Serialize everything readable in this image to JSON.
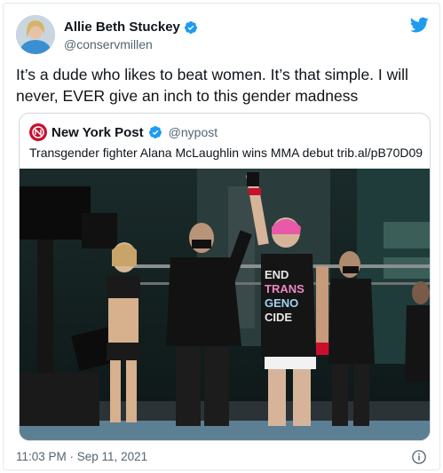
{
  "tweet": {
    "display_name": "Allie Beth Stuckey",
    "handle": "@conservmillen",
    "text": "It’s a dude who likes to beat women. It’s that simple. I will never, EVER give an inch to this gender madness",
    "timestamp": "11:03 PM · Sep 11, 2021"
  },
  "quote": {
    "display_name": "New York Post",
    "handle": "@nypost",
    "text": "Transgender fighter Alana McLaughlin wins MMA debut trib.al/pB70D09",
    "image_shirt_text": "END TRANS GENO CIDE"
  },
  "icons": {
    "verified": "verified-badge-icon",
    "brand": "twitter-bird-icon",
    "info": "info-icon"
  },
  "colors": {
    "accent": "#1d9bf0",
    "text": "#0f1419",
    "secondary_text": "#536471",
    "border": "#cfd9de",
    "nypost_red": "#c8102e"
  }
}
